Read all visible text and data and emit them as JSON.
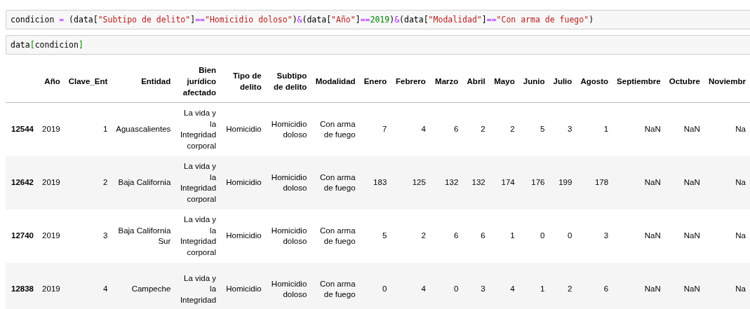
{
  "cells": [
    {
      "code": [
        {
          "kind": "name",
          "text": "condicion "
        },
        {
          "kind": "op",
          "text": "="
        },
        {
          "kind": "name",
          "text": " (data["
        },
        {
          "kind": "str",
          "text": "\"Subtipo de delito\""
        },
        {
          "kind": "name",
          "text": "]"
        },
        {
          "kind": "op",
          "text": "=="
        },
        {
          "kind": "str",
          "text": "\"Homicidio doloso\""
        },
        {
          "kind": "name",
          "text": ")"
        },
        {
          "kind": "op",
          "text": "&"
        },
        {
          "kind": "name",
          "text": "(data["
        },
        {
          "kind": "str",
          "text": "\"Año\""
        },
        {
          "kind": "name",
          "text": "]"
        },
        {
          "kind": "op",
          "text": "=="
        },
        {
          "kind": "num",
          "text": "2019"
        },
        {
          "kind": "name",
          "text": ")"
        },
        {
          "kind": "op",
          "text": "&"
        },
        {
          "kind": "name",
          "text": "(data["
        },
        {
          "kind": "str",
          "text": "\"Modalidad\""
        },
        {
          "kind": "name",
          "text": "]"
        },
        {
          "kind": "op",
          "text": "=="
        },
        {
          "kind": "str",
          "text": "\"Con arma de fuego\""
        },
        {
          "kind": "name",
          "text": ")"
        }
      ]
    },
    {
      "code": [
        {
          "kind": "name",
          "text": "data"
        },
        {
          "kind": "bracket",
          "text": "["
        },
        {
          "kind": "name",
          "text": "condicion"
        },
        {
          "kind": "bracket",
          "text": "]"
        }
      ]
    }
  ],
  "table": {
    "columns": [
      "",
      "Año",
      "Clave_Ent",
      "Entidad",
      "Bien jurídico afectado",
      "Tipo de delito",
      "Subtipo de delito",
      "Modalidad",
      "Enero",
      "Febrero",
      "Marzo",
      "Abril",
      "Mayo",
      "Junio",
      "Julio",
      "Agosto",
      "Septiembre",
      "Octubre",
      "Noviembr"
    ],
    "rows": [
      [
        "12544",
        "2019",
        "1",
        "Aguascalientes",
        "La vida y la Integridad corporal",
        "Homicidio",
        "Homicidio doloso",
        "Con arma de fuego",
        "7",
        "4",
        "6",
        "2",
        "2",
        "5",
        "3",
        "1",
        "NaN",
        "NaN",
        "Na"
      ],
      [
        "12642",
        "2019",
        "2",
        "Baja California",
        "La vida y la Integridad corporal",
        "Homicidio",
        "Homicidio doloso",
        "Con arma de fuego",
        "183",
        "125",
        "132",
        "132",
        "174",
        "176",
        "199",
        "178",
        "NaN",
        "NaN",
        "Na"
      ],
      [
        "12740",
        "2019",
        "3",
        "Baja California Sur",
        "La vida y la Integridad corporal",
        "Homicidio",
        "Homicidio doloso",
        "Con arma de fuego",
        "5",
        "2",
        "6",
        "6",
        "1",
        "0",
        "0",
        "3",
        "NaN",
        "NaN",
        "Na"
      ],
      [
        "12838",
        "2019",
        "4",
        "Campeche",
        "La vida y la Integridad",
        "Homicidio",
        "Homicidio doloso",
        "Con arma de fuego",
        "0",
        "4",
        "0",
        "3",
        "4",
        "1",
        "2",
        "6",
        "NaN",
        "NaN",
        "Na"
      ]
    ]
  }
}
